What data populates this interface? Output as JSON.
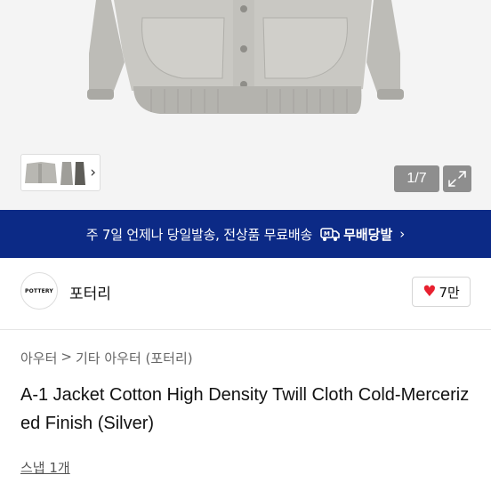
{
  "gallery": {
    "counter": "1/7",
    "thumbnail_nav_icon": "chevron-right-icon",
    "expand_icon": "expand-icon"
  },
  "banner": {
    "text": "주 7일 언제나 당일발송, 전상품 무료배송",
    "badge_label": "무배당발",
    "badge_icon": "delivery-truck-icon",
    "arrow": "›",
    "background_color": "#0c2a86"
  },
  "seller": {
    "logo_text": "POTTERY",
    "name": "포터리",
    "like_count": "7만",
    "like_icon": "heart-icon",
    "like_color": "#e8202f"
  },
  "breadcrumb": {
    "level1": "아우터",
    "separator": ">",
    "level2": "기타 아우터 (포터리)"
  },
  "product": {
    "title": "A-1 Jacket Cotton High Density Twill Cloth Cold-Mercerized Finish (Silver)",
    "rating_text": "스냅 1개"
  }
}
